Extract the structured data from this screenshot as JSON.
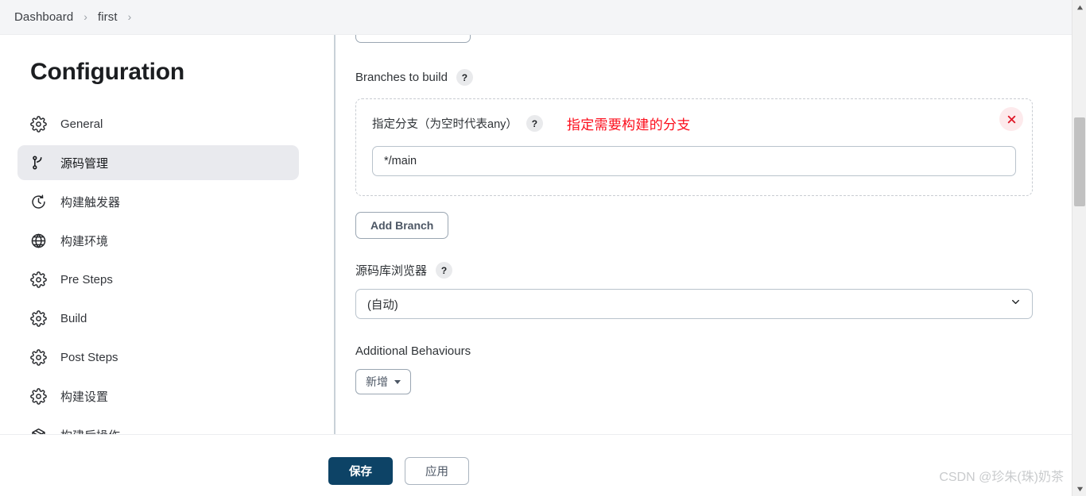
{
  "breadcrumb": {
    "items": [
      {
        "label": "Dashboard"
      },
      {
        "label": "first"
      }
    ],
    "separator": "›"
  },
  "sidebar": {
    "title": "Configuration",
    "items": [
      {
        "label": "General",
        "icon": "gear-icon",
        "active": false
      },
      {
        "label": "源码管理",
        "icon": "git-branch-icon",
        "active": true
      },
      {
        "label": "构建触发器",
        "icon": "clock-icon",
        "active": false
      },
      {
        "label": "构建环境",
        "icon": "globe-icon",
        "active": false
      },
      {
        "label": "Pre Steps",
        "icon": "gear-icon",
        "active": false
      },
      {
        "label": "Build",
        "icon": "gear-icon",
        "active": false
      },
      {
        "label": "Post Steps",
        "icon": "gear-icon",
        "active": false
      },
      {
        "label": "构建设置",
        "icon": "gear-icon",
        "active": false
      },
      {
        "label": "构建后操作",
        "icon": "package-icon",
        "active": false
      }
    ]
  },
  "main": {
    "branches_section": {
      "label": "Branches to build",
      "help": "?",
      "branch_row": {
        "label": "指定分支（为空时代表any）",
        "help": "?",
        "annotation": "指定需要构建的分支",
        "input_value": "*/main",
        "input_placeholder": "",
        "delete_icon": "close-icon"
      },
      "add_branch_label": "Add Branch"
    },
    "repo_browser": {
      "label": "源码库浏览器",
      "help": "?",
      "selected": "(自动)",
      "options": [
        "(自动)"
      ]
    },
    "additional_behaviours": {
      "label": "Additional Behaviours",
      "add_label": "新增"
    }
  },
  "footer": {
    "save_label": "保存",
    "apply_label": "应用",
    "watermark": "CSDN @珍朱(珠)奶茶"
  },
  "colors": {
    "accent": "#0d4366",
    "danger": "#fc0d1b",
    "active_nav_bg": "#e9eaee",
    "divider": "#c9d1d8"
  }
}
